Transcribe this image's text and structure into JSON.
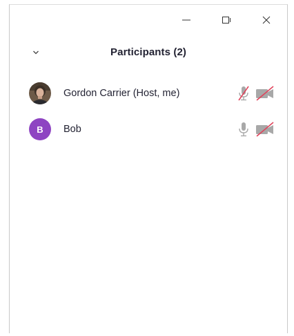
{
  "window": {
    "controls": {
      "minimize": "minimize-icon",
      "popout": "popout-icon",
      "close": "close-icon"
    }
  },
  "header": {
    "title": "Participants (2)",
    "collapse_icon": "chevron-down-icon"
  },
  "participants": [
    {
      "name": "Gordon Carrier (Host, me)",
      "avatar": "photo",
      "mic": "muted",
      "video": "off"
    },
    {
      "name": "Bob",
      "avatar_letter": "B",
      "avatar_color": "#8e44c2",
      "mic": "unmuted",
      "video": "off"
    }
  ],
  "colors": {
    "mute_slash": "#e0435b",
    "icon_gray": "#a8a8a8",
    "text": "#232333"
  }
}
